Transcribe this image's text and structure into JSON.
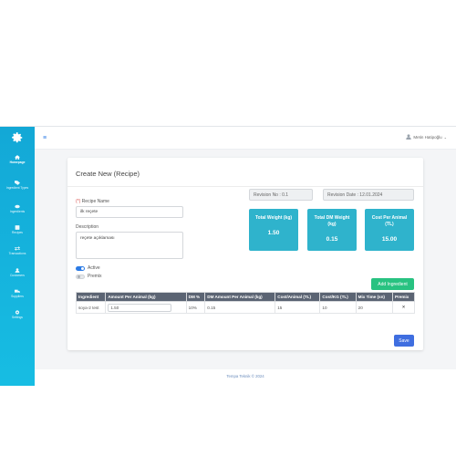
{
  "sidebar": {
    "items": [
      {
        "label": "Homepage",
        "icon": "home-icon"
      },
      {
        "label": "Ingredient Types",
        "icon": "tag-icon"
      },
      {
        "label": "Ingredients",
        "icon": "leaf-icon"
      },
      {
        "label": "Recipes",
        "icon": "book-icon"
      },
      {
        "label": "Transactions",
        "icon": "swap-icon"
      },
      {
        "label": "Customers",
        "icon": "users-icon"
      },
      {
        "label": "Suppliers",
        "icon": "truck-icon"
      },
      {
        "label": "Settings",
        "icon": "gear-icon"
      }
    ]
  },
  "header": {
    "user_name": "Metin Hatipoğlu"
  },
  "page": {
    "title": "Create New (Recipe)"
  },
  "form": {
    "name_required_marker": "(*)",
    "name_label": "Recipe Name",
    "name_value": "ilk reçete",
    "description_label": "Description",
    "description_value": "reçete açıklaması",
    "active_label": "Active",
    "premix_label": "Premix",
    "active_on": true,
    "premix_on": false
  },
  "revision": {
    "no": "Revision No : 0.1",
    "date": "Revision Date : 12.01.2024"
  },
  "stats": [
    {
      "title": "Total Weight (kg)",
      "value": "1.50"
    },
    {
      "title": "Total DM Weight (kg)",
      "value": "0.15"
    },
    {
      "title": "Cost Per Animal (TL)",
      "value": "15.00"
    }
  ],
  "buttons": {
    "add_ingredient": "Add Ingredient",
    "save": "Save"
  },
  "table": {
    "headers": [
      "Ingredient",
      "Amount Per Animal (kg)",
      "DM %",
      "DM Amount Per Animal (kg)",
      "Cost/Animal (TL)",
      "Cost/KG (TL)",
      "Mix Time (sn)",
      "Premix"
    ],
    "rows": [
      {
        "ingredient": "soya-2 test",
        "amount": "1.50",
        "dm": "10%",
        "dm_amount": "0.15",
        "cost_animal": "15",
        "cost_kg": "10",
        "mix_time": "20",
        "premix": "✕"
      }
    ]
  },
  "footer": {
    "text": "Tempa Teknik © 2024"
  },
  "colors": {
    "sidebar": "#13a8d6",
    "stat": "#2fb3cc",
    "green": "#28c281",
    "blue": "#3f6ee0",
    "table_header": "#5b6473"
  }
}
